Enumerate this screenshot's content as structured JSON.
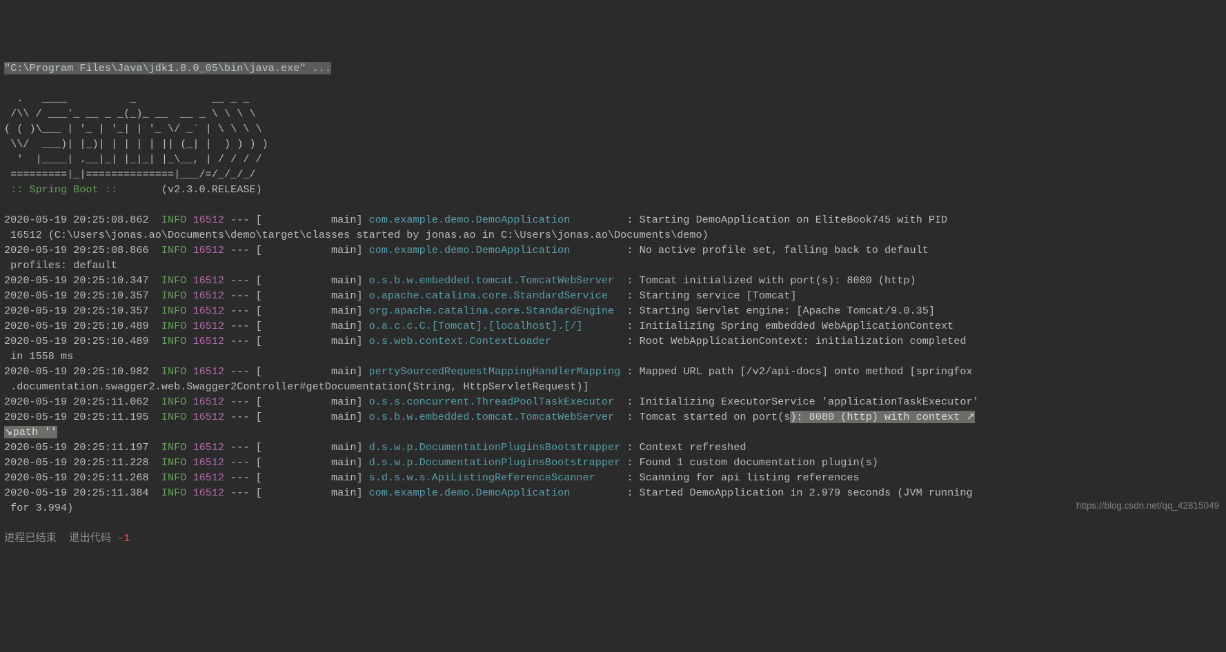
{
  "header_cmd": "\"C:\\Program Files\\Java\\jdk1.8.0_05\\bin\\java.exe\" ...",
  "banner": [
    "  .   ____          _            __ _ _",
    " /\\\\ / ___'_ __ _ _(_)_ __  __ _ \\ \\ \\ \\",
    "( ( )\\___ | '_ | '_| | '_ \\/ _` | \\ \\ \\ \\",
    " \\\\/  ___)| |_)| | | | | || (_| |  ) ) ) )",
    "  '  |____| .__|_| |_|_| |_\\__, | / / / /",
    " =========|_|==============|___/=/_/_/_/"
  ],
  "spring_label": " :: Spring Boot :: ",
  "spring_version": "      (v2.3.0.RELEASE)",
  "log": {
    "l0": {
      "ts": "2020-05-19 20:25:08.862",
      "pid": "16512",
      "thread": "           main",
      "logger": "com.example.demo.DemoApplication        ",
      "msg": "Starting DemoApplication on EliteBook745 with PID"
    },
    "l0b": " 16512 (C:\\Users\\jonas.ao\\Documents\\demo\\target\\classes started by jonas.ao in C:\\Users\\jonas.ao\\Documents\\demo)",
    "l1": {
      "ts": "2020-05-19 20:25:08.866",
      "pid": "16512",
      "thread": "           main",
      "logger": "com.example.demo.DemoApplication        ",
      "msg": "No active profile set, falling back to default"
    },
    "l1b": " profiles: default",
    "l2": {
      "ts": "2020-05-19 20:25:10.347",
      "pid": "16512",
      "thread": "           main",
      "logger": "o.s.b.w.embedded.tomcat.TomcatWebServer ",
      "msg": "Tomcat initialized with port(s): 8080 (http)"
    },
    "l3": {
      "ts": "2020-05-19 20:25:10.357",
      "pid": "16512",
      "thread": "           main",
      "logger": "o.apache.catalina.core.StandardService  ",
      "msg": "Starting service [Tomcat]"
    },
    "l4": {
      "ts": "2020-05-19 20:25:10.357",
      "pid": "16512",
      "thread": "           main",
      "logger": "org.apache.catalina.core.StandardEngine ",
      "msg": "Starting Servlet engine: [Apache Tomcat/9.0.35]"
    },
    "l5": {
      "ts": "2020-05-19 20:25:10.489",
      "pid": "16512",
      "thread": "           main",
      "logger": "o.a.c.c.C.[Tomcat].[localhost].[/]      ",
      "msg": "Initializing Spring embedded WebApplicationContext"
    },
    "l6": {
      "ts": "2020-05-19 20:25:10.489",
      "pid": "16512",
      "thread": "           main",
      "logger": "o.s.web.context.ContextLoader           ",
      "msg": "Root WebApplicationContext: initialization completed"
    },
    "l6b": " in 1558 ms",
    "l7": {
      "ts": "2020-05-19 20:25:10.982",
      "pid": "16512",
      "thread": "           main",
      "logger": "pertySourcedRequestMappingHandlerMapping",
      "msg": "Mapped URL path [/v2/api-docs] onto method [springfox"
    },
    "l7b": " .documentation.swagger2.web.Swagger2Controller#getDocumentation(String, HttpServletRequest)]",
    "l8": {
      "ts": "2020-05-19 20:25:11.062",
      "pid": "16512",
      "thread": "           main",
      "logger": "o.s.s.concurrent.ThreadPoolTaskExecutor ",
      "msg": "Initializing ExecutorService 'applicationTaskExecutor'"
    },
    "l9": {
      "ts": "2020-05-19 20:25:11.195",
      "pid": "16512",
      "thread": "           main",
      "logger": "o.s.b.w.embedded.tomcat.TomcatWebServer ",
      "msg_a": "Tomcat started on port(s",
      "msg_b": "): 8080 (http) with context ↗"
    },
    "l9b": "↘path ''",
    "l10": {
      "ts": "2020-05-19 20:25:11.197",
      "pid": "16512",
      "thread": "           main",
      "logger": "d.s.w.p.DocumentationPluginsBootstrapper",
      "msg": "Context refreshed"
    },
    "l11": {
      "ts": "2020-05-19 20:25:11.228",
      "pid": "16512",
      "thread": "           main",
      "logger": "d.s.w.p.DocumentationPluginsBootstrapper",
      "msg": "Found 1 custom documentation plugin(s)"
    },
    "l12": {
      "ts": "2020-05-19 20:25:11.268",
      "pid": "16512",
      "thread": "           main",
      "logger": "s.d.s.w.s.ApiListingReferenceScanner    ",
      "msg": "Scanning for api listing references"
    },
    "l13": {
      "ts": "2020-05-19 20:25:11.384",
      "pid": "16512",
      "thread": "           main",
      "logger": "com.example.demo.DemoApplication        ",
      "msg": "Started DemoApplication in 2.979 seconds (JVM running"
    },
    "l13b": " for 3.994)"
  },
  "level": "INFO",
  "sep": " --- [",
  "close": "] ",
  "colon": " : ",
  "exit_a": "进程已结束  退出代码 ",
  "exit_b": "-1",
  "watermark": "https://blog.csdn.net/qq_42815049"
}
